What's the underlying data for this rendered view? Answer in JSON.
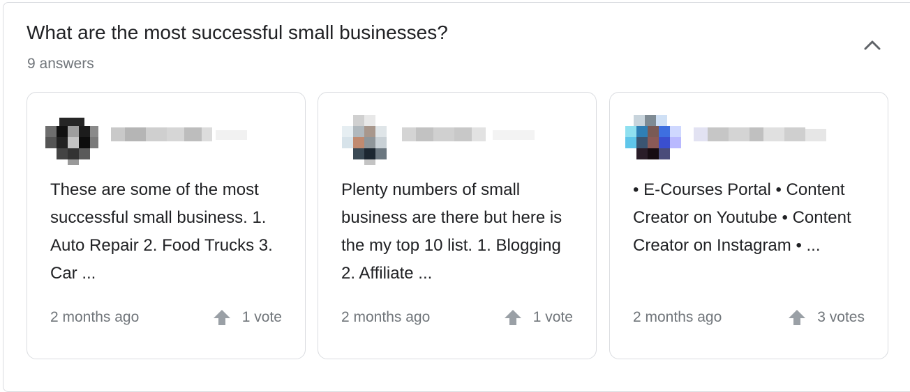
{
  "question": "What are the most successful small businesses?",
  "answers_count": "9 answers",
  "icons": {
    "collapse": "chevron-up-icon",
    "upvote": "upvote-arrow-icon"
  },
  "colors": {
    "title": "#202124",
    "secondary": "#70757a",
    "border": "#dadce0",
    "arrow": "#9aa0a6"
  },
  "cards": [
    {
      "text": "These are some of the most successful small business. 1. Auto Repair 2. Food Trucks 3. Car ...",
      "time": "2 months ago",
      "votes": "1 vote"
    },
    {
      "text": "Plenty numbers of small business are there but here is the my top 10 list. 1. Blogging 2. Affiliate ...",
      "time": "2 months ago",
      "votes": "1 vote"
    },
    {
      "text": "• E-Courses Portal • Content Creator on Youtube • Content Creator on Instagram • ...",
      "time": "2 months ago",
      "votes": "3 votes"
    }
  ]
}
